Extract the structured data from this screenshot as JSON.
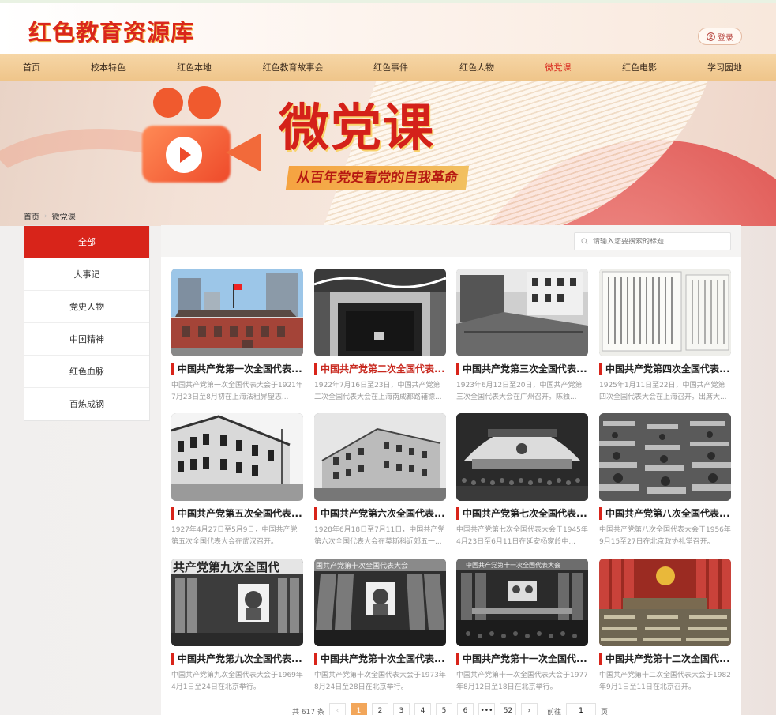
{
  "site": {
    "logo": "红色教育资源库",
    "login_label": "登录"
  },
  "nav": [
    {
      "label": "首页"
    },
    {
      "label": "校本特色"
    },
    {
      "label": "红色本地"
    },
    {
      "label": "红色教育故事会"
    },
    {
      "label": "红色事件"
    },
    {
      "label": "红色人物"
    },
    {
      "label": "微党课",
      "active": true
    },
    {
      "label": "红色电影"
    },
    {
      "label": "学习园地"
    }
  ],
  "banner": {
    "title": "微党课",
    "subtitle": "从百年党史看党的自我革命"
  },
  "breadcrumb": {
    "home": "首页",
    "current": "微党课"
  },
  "sidebar": [
    {
      "label": "全部",
      "active": true
    },
    {
      "label": "大事记"
    },
    {
      "label": "党史人物"
    },
    {
      "label": "中国精神"
    },
    {
      "label": "红色血脉"
    },
    {
      "label": "百炼成钢"
    }
  ],
  "search": {
    "placeholder": "请输入您要搜索的标题"
  },
  "cards": [
    {
      "title": "中国共产党第一次全国代表...",
      "desc": "中国共产党第一次全国代表大会于1921年7月23日至8月初在上海法租界望志..."
    },
    {
      "title": "中国共产党第二次全国代表...",
      "desc": "1922年7月16日至23日，中国共产党第二次全国代表大会在上海南成都路辅德...",
      "highlight": true
    },
    {
      "title": "中国共产党第三次全国代表...",
      "desc": "1923年6月12日至20日，中国共产党第三次全国代表大会在广州召开。陈独..."
    },
    {
      "title": "中国共产党第四次全国代表...",
      "desc": "1925年1月11日至22日，中国共产党第四次全国代表大会在上海召开。出席大..."
    },
    {
      "title": "中国共产党第五次全国代表...",
      "desc": "1927年4月27日至5月9日，中国共产党第五次全国代表大会在武汉召开。"
    },
    {
      "title": "中国共产党第六次全国代表...",
      "desc": "1928年6月18日至7月11日，中国共产党第六次全国代表大会在莫斯科近郊五一..."
    },
    {
      "title": "中国共产党第七次全国代表...",
      "desc": "中国共产党第七次全国代表大会于1945年4月23日至6月11日在延安杨家岭中..."
    },
    {
      "title": "中国共产党第八次全国代表...",
      "desc": "中国共产党第八次全国代表大会于1956年9月15至27日在北京政协礼堂召开。"
    },
    {
      "title": "中国共产党第九次全国代表...",
      "desc": "中国共产党第九次全国代表大会于1969年4月1日至24日在北京举行。",
      "banner": "共产党第九次全国代"
    },
    {
      "title": "中国共产党第十次全国代表...",
      "desc": "中国共产党第十次全国代表大会于1973年8月24日至28日在北京举行。",
      "banner": "国共产党第十次全国代表大会"
    },
    {
      "title": "中国共产党第十一次全国代...",
      "desc": "中国共产党第十一次全国代表大会于1977年8月12日至18日在北京举行。",
      "banner": "中国共产党第十一次全国代表大会"
    },
    {
      "title": "中国共产党第十二次全国代...",
      "desc": "中国共产党第十二次全国代表大会于1982年9月1日至11日在北京召开。"
    }
  ],
  "pagination": {
    "total_prefix": "共",
    "total": "617",
    "total_suffix": "条",
    "prev": "‹",
    "next": "›",
    "pages": [
      "1",
      "2",
      "3",
      "4",
      "5",
      "6",
      "•••",
      "52"
    ],
    "current": "1",
    "goto_prefix": "前往",
    "goto_value": "1",
    "goto_suffix": "页"
  },
  "colors": {
    "accent": "#d8241a",
    "nav_bg": "#f2cd96",
    "page_active": "#f2a65a"
  }
}
